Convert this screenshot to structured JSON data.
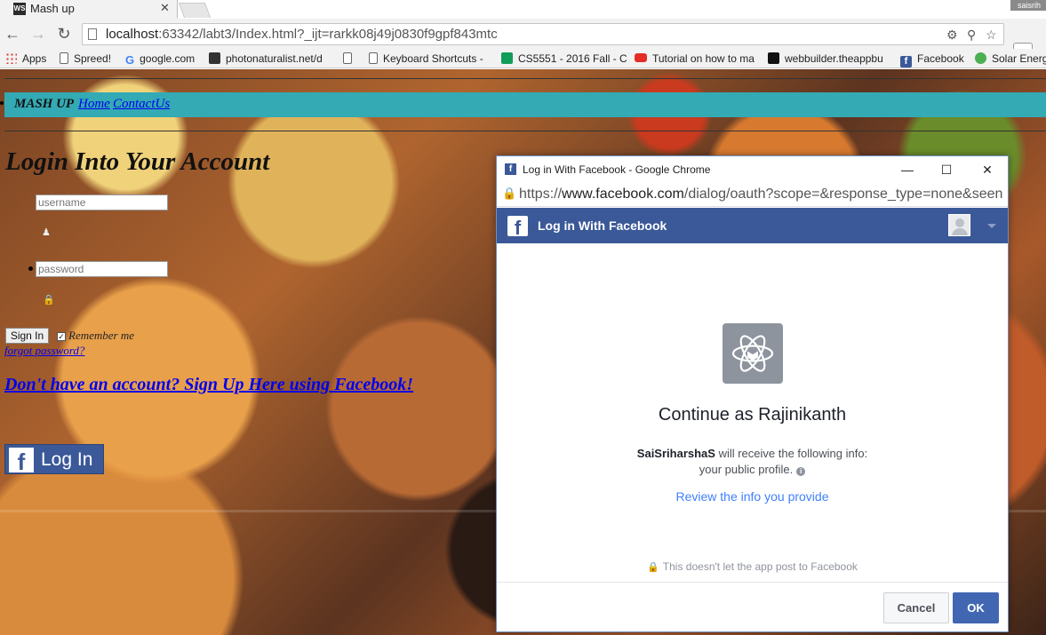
{
  "browser": {
    "tab_title": "Mash up",
    "tab_favicon": "WS",
    "tab_close": "✕",
    "profile_name": "saisrih",
    "url_host": "localhost",
    "url_rest": ":63342/labt3/Index.html?_ijt=rarkk08j49j0830f9gpf843mtc",
    "bookmarks": [
      {
        "label": "Apps",
        "icon": "apps-icon"
      },
      {
        "label": "Spreed!",
        "icon": "page-icon"
      },
      {
        "label": "google.com",
        "icon": "google-icon"
      },
      {
        "label": "photonaturalist.net/d",
        "icon": "camera-icon"
      },
      {
        "label": "",
        "icon": "page-icon"
      },
      {
        "label": "Keyboard Shortcuts -",
        "icon": "page-icon"
      },
      {
        "label": "CS5551 - 2016 Fall - C",
        "icon": "sheets-icon"
      },
      {
        "label": "Tutorial on how to ma",
        "icon": "youtube-icon"
      },
      {
        "label": "webbuilder.theappbu",
        "icon": "star-icon"
      },
      {
        "label": "Facebook",
        "icon": "facebook-icon"
      },
      {
        "label": "Solar Energ",
        "icon": "recycle-icon"
      }
    ]
  },
  "page": {
    "nav": {
      "brand": "MASH UP",
      "home": "Home",
      "contact": "ContactUs"
    },
    "login_heading": "Login Into Your Account",
    "username_placeholder": "username",
    "password_placeholder": "password",
    "signin_label": "Sign In",
    "remember_label": "Remember me",
    "forgot_label": "forgot password?",
    "signup_label": "Don't have an account? Sign Up Here using Facebook!",
    "fb_login_label": "Log In",
    "fb_login_icon": "f"
  },
  "popup": {
    "window_title": "Log in With Facebook - Google Chrome",
    "url_prefix": "https://",
    "url_main": "www.facebook.com",
    "url_rest": "/dialog/oauth?scope=&response_type=none&seen",
    "header_title": "Log in With Facebook",
    "continue_text": "Continue as Rajinikanth",
    "app_name": "SaiSriharshaS",
    "info_text": " will receive the following info:",
    "profile_text": "your public profile.",
    "info_icon": "i",
    "review_link": "Review the info you provide",
    "no_post_text": "This doesn't let the app post to Facebook",
    "cancel_label": "Cancel",
    "ok_label": "OK",
    "brand_color": "#3b5998",
    "ok_color": "#4267b2",
    "link_color": "#4080ff"
  }
}
